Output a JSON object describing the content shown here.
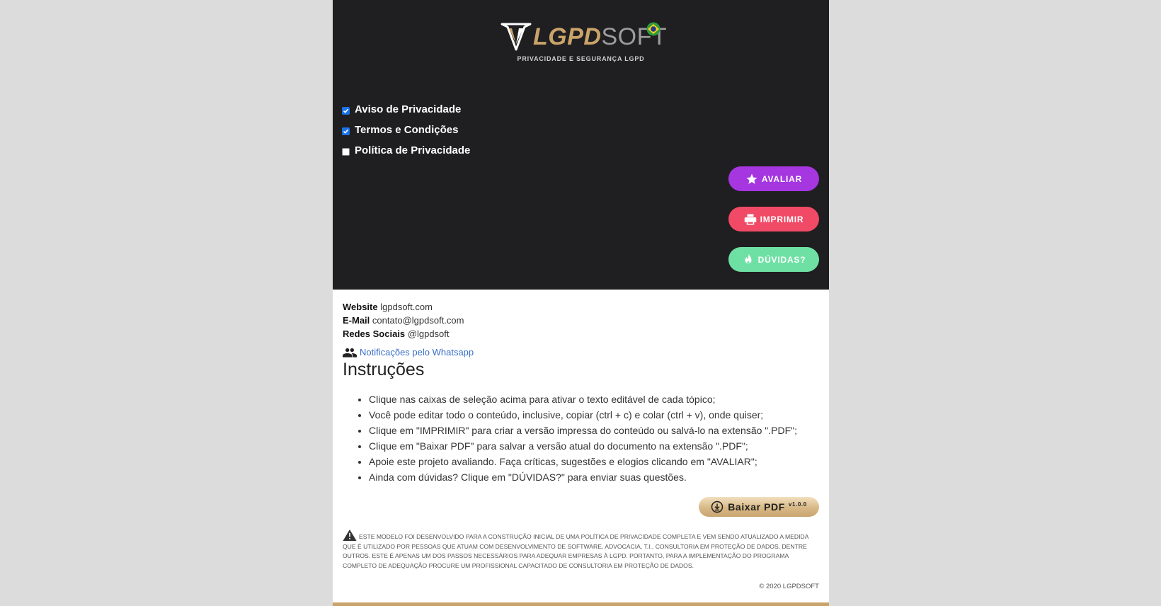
{
  "colors": {
    "background": "#dcdcdc",
    "header": "#1f1e20",
    "gold": "#c9a36a",
    "avaliar": "#a536e0",
    "imprimir": "#f04a66",
    "duvidas": "#6fe0a4",
    "link": "#3a6fc7"
  },
  "logo": {
    "text_lgpd": "LGPD",
    "text_soft": "SOFT",
    "tagline": "PRIVACIDADE E SEGURANÇA LGPD"
  },
  "checkboxes": [
    {
      "label": "Aviso de Privacidade",
      "checked": true
    },
    {
      "label": "Termos e Condições",
      "checked": true
    },
    {
      "label": "Política de Privacidade",
      "checked": false
    }
  ],
  "buttons": {
    "avaliar": {
      "label": "AVALIAR",
      "icon": "star-icon"
    },
    "imprimir": {
      "label": "IMPRIMIR",
      "icon": "printer-icon"
    },
    "duvidas": {
      "label": "DÚVIDAS?",
      "icon": "flame-icon"
    }
  },
  "contact": {
    "website_label": "Website",
    "website_value": "lgpdsoft.com",
    "email_label": "E-Mail",
    "email_value": "contato@lgpdsoft.com",
    "social_label": "Redes Sociais",
    "social_value": "@lgpdsoft",
    "whatsapp_link": "Notificações pelo Whatsapp"
  },
  "instructions": {
    "title": "Instruções",
    "items": [
      "Clique nas caixas de seleção acima para ativar o texto editável de cada tópico;",
      "Você pode editar todo o conteúdo, inclusive, copiar (ctrl + c) e colar (ctrl + v), onde quiser;",
      "Clique em \"IMPRIMIR\" para criar a versão impressa do conteúdo ou salvá-lo na extensão \".PDF\";",
      "Clique em \"Baixar PDF\" para salvar a versão atual do documento na extensão \".PDF\";",
      "Apoie este projeto avaliando. Faça críticas, sugestões e elogios clicando em \"AVALIAR\";",
      "Ainda com dúvidas? Clique em \"DÚVIDAS?\" para enviar suas questões."
    ]
  },
  "download": {
    "label": "Baixar PDF",
    "version": "v1.0.0"
  },
  "disclaimer": "Este modelo foi desenvolvido para a construção inicial de uma política de privacidade completa e vem sendo atualizado a medida que é utilizado por pessoas que atuam com desenvolvimento de software, advocacia, T.I., consultoria em proteção de dados, dentre outros. Este é apenas um dos passos necessários para adequar empresas à LGPD. Portanto, para a implementação do programa completo de adequação procure um profissional capacitado de consultoria em proteção de dados.",
  "copyright": "© 2020 LGPDSOFT"
}
